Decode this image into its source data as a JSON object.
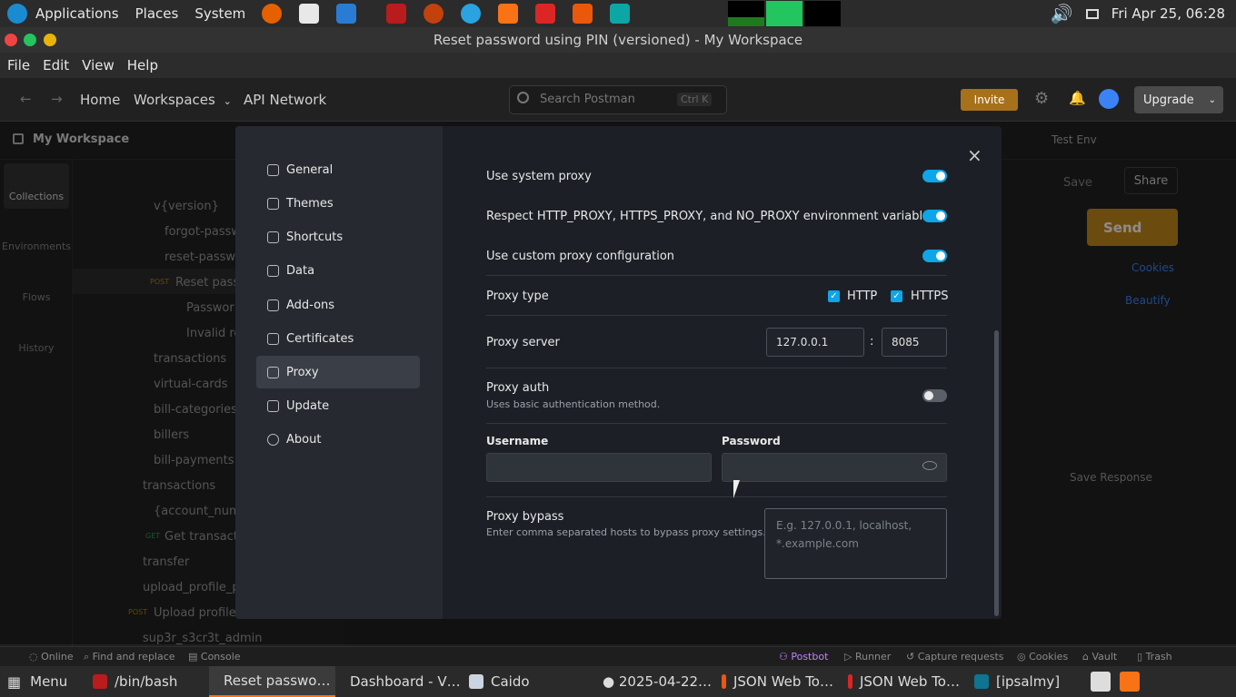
{
  "system": {
    "applications": "Applications",
    "places": "Places",
    "system": "System",
    "clock": "Fri Apr 25, 06:28"
  },
  "window": {
    "title": "Reset password using PIN (versioned) - My Workspace"
  },
  "menubar": {
    "file": "File",
    "edit": "Edit",
    "view": "View",
    "help": "Help"
  },
  "header": {
    "home": "Home",
    "workspaces": "Workspaces",
    "api_network": "API Network",
    "search_placeholder": "Search Postman",
    "search_shortcut": "Ctrl K",
    "invite": "Invite",
    "upgrade": "Upgrade"
  },
  "workspace": {
    "name": "My Workspace",
    "env": "Test Env",
    "save": "Save",
    "share": "Share",
    "send": "Send",
    "cookies": "Cookies",
    "beautify": "Beautify",
    "save_response": "Save Response"
  },
  "left_rail": [
    "Collections",
    "Environments",
    "Flows",
    "History"
  ],
  "tree": [
    "v{version}",
    "forgot-passw",
    "reset-passwo",
    "Reset passw",
    "Passwor",
    "Invalid re",
    "transactions",
    "virtual-cards",
    "bill-categories",
    "billers",
    "bill-payments",
    "transactions",
    "{account_numb",
    "Get transacti",
    "transfer",
    "upload_profile_pic",
    "Upload profile p",
    "sup3r_s3cr3t_admin"
  ],
  "tree_methods": {
    "post1": "POST",
    "get1": "GET",
    "post2": "POST"
  },
  "settings": {
    "nav": [
      "General",
      "Themes",
      "Shortcuts",
      "Data",
      "Add-ons",
      "Certificates",
      "Proxy",
      "Update",
      "About"
    ],
    "use_system_proxy": "Use system proxy",
    "respect_env": "Respect HTTP_PROXY, HTTPS_PROXY, and NO_PROXY environment variables",
    "custom_proxy": "Use custom proxy configuration",
    "proxy_type": "Proxy type",
    "http": "HTTP",
    "https": "HTTPS",
    "proxy_server": "Proxy server",
    "server_host": "127.0.0.1",
    "server_port": "8085",
    "colon": ":",
    "proxy_auth": "Proxy auth",
    "proxy_auth_sub": "Uses basic authentication method.",
    "username": "Username",
    "password": "Password",
    "proxy_bypass": "Proxy bypass",
    "proxy_bypass_sub": "Enter comma separated hosts to bypass proxy settings.",
    "bypass_placeholder": "E.g. 127.0.0.1, localhost, *.example.com"
  },
  "statusbar": {
    "online": "Online",
    "find": "Find and replace",
    "console": "Console",
    "postbot": "Postbot",
    "runner": "Runner",
    "capture": "Capture requests",
    "cookies": "Cookies",
    "vault": "Vault",
    "trash": "Trash"
  },
  "taskbar": {
    "menu": "Menu",
    "items": [
      "/bin/bash",
      "Reset passwo…",
      "Dashboard - V…",
      "Caido",
      "● 2025-04-22…",
      "JSON Web To…",
      "JSON Web To…",
      "[ipsalmy]"
    ]
  },
  "colors": {
    "accent": "#0ea5e9",
    "send": "#c58a1a",
    "postman": "#f97316"
  }
}
